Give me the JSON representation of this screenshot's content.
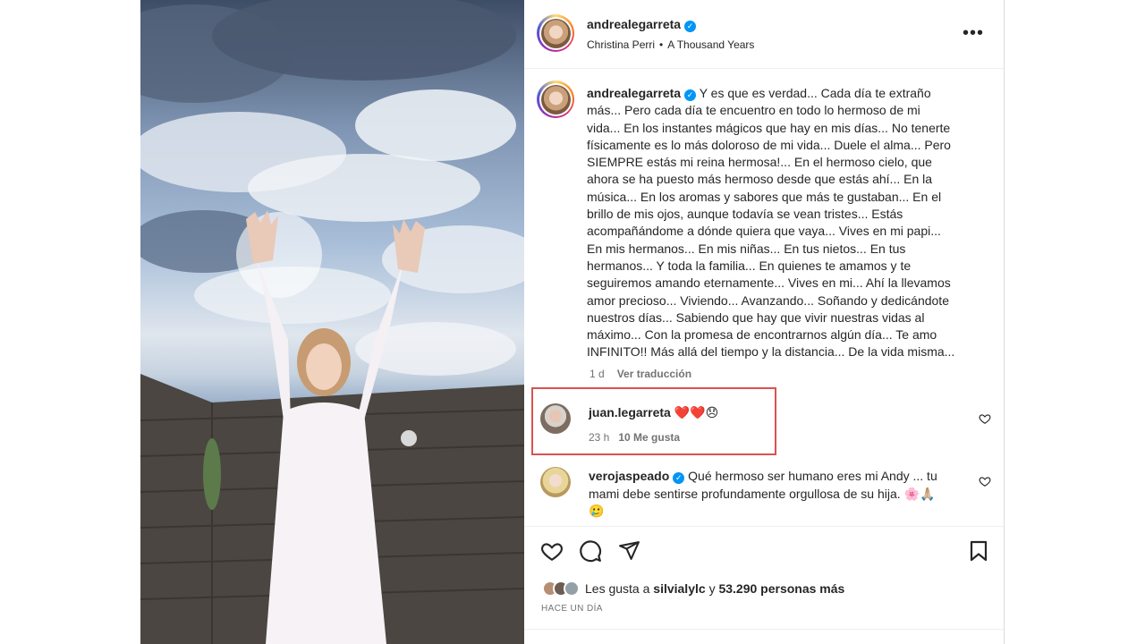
{
  "post": {
    "author": "andrealegarreta",
    "audio_artist": "Christina Perri",
    "audio_track": "A Thousand Years",
    "more_icon": "more-horizontal-icon",
    "caption_lines": [
      "Y es que es verdad... Cada día te extraño",
      "más... Pero cada día te encuentro en todo lo hermoso de mi",
      "vida... En los instantes mágicos que hay en mis días... No tenerte",
      "físicamente es lo más doloroso de mi vida... Duele el alma... Pero",
      "SIEMPRE estás mi reina hermosa!... En el hermoso cielo, que",
      "ahora se ha puesto más hermoso desde que estás ahí... En la",
      "música... En los aromas y sabores que más te gustaban... En el",
      "brillo de mis ojos, aunque todavía se vean tristes... Estás",
      "acompañándome a dónde quiera que vaya... Vives en mi papi...",
      "En mis hermanos... En mis niñas... En tus nietos... En tus",
      "hermanos... Y toda la familia... En quienes te amamos y te",
      "seguiremos amando eternamente... Vives en mi... Ahí la llevamos",
      "amor precioso... Viviendo... Avanzando... Soñando y dedicándote",
      "nuestros días... Sabiendo que hay que vivir nuestras vidas al",
      "máximo... Con la promesa de encontrarnos algún día... Te amo",
      "INFINITO!! Más allá del tiempo y la distancia... De la vida misma..."
    ],
    "caption_age": "1 d",
    "see_translation": "Ver traducción"
  },
  "comments": [
    {
      "user": "juan.legarreta",
      "text": "❤️❤️😞",
      "age": "23 h",
      "likes": "10 Me gusta"
    },
    {
      "user": "verojaspeado",
      "text_line1": "Qué hermoso ser humano eres mi Andy ... tu",
      "text_line2": "mami debe sentirse profundamente orgullosa de su hija. 🌸🙏🏼",
      "text_line3": "🥲"
    }
  ],
  "footer": {
    "likes_prefix": "Les gusta a",
    "likes_user": "silvialylc",
    "likes_middle": "y",
    "likes_count": "53.290 personas más",
    "date": "HACE UN DÍA"
  },
  "colors": {
    "verified": "#0095f6",
    "highlight_box": "#d9534f",
    "text": "#262626",
    "secondary": "#737373"
  }
}
